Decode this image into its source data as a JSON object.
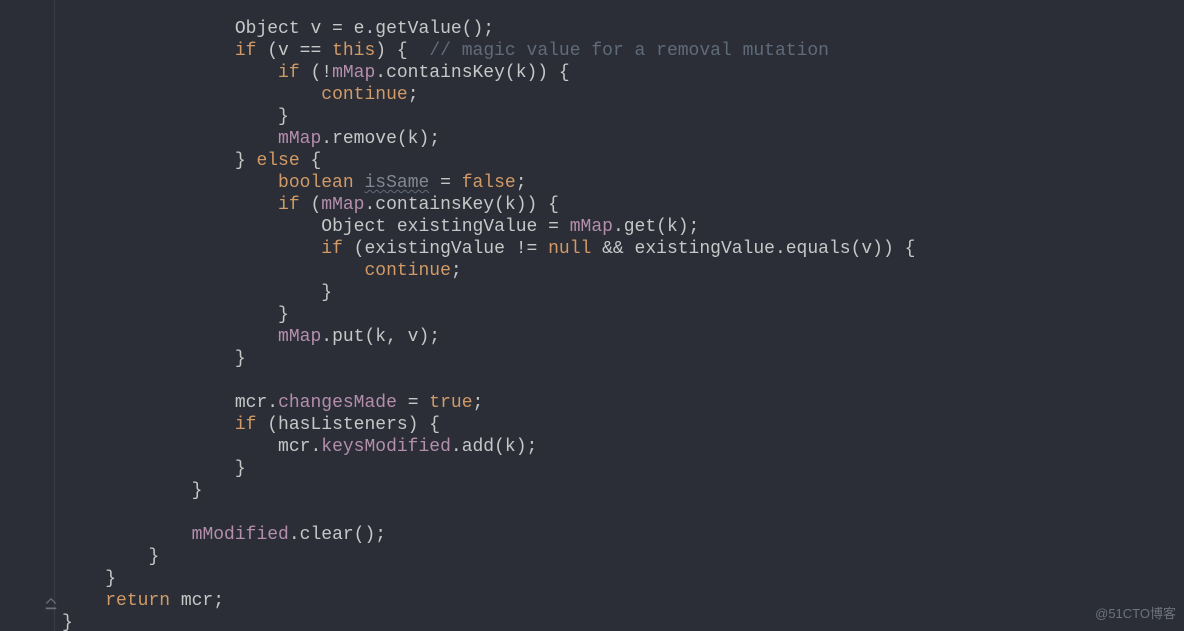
{
  "watermark": "@51CTO博客",
  "code": {
    "l0": {
      "ind": "            ",
      "a": "Object v = e.getValue();"
    },
    "l1": {
      "ind": "            ",
      "kw": "if",
      "a": " (v == ",
      "kw2": "this",
      "b": ") {  ",
      "cmt": "// magic value for a removal mutation"
    },
    "l2": {
      "ind": "                ",
      "kw": "if",
      "a": " (!",
      "fld": "mMap",
      "b": ".containsKey(k)) {"
    },
    "l3": {
      "ind": "                    ",
      "kw": "continue",
      "a": ";"
    },
    "l4": {
      "ind": "                ",
      "a": "}"
    },
    "l5": {
      "ind": "                ",
      "fld": "mMap",
      "a": ".remove(k);"
    },
    "l6": {
      "ind": "            ",
      "a": "} ",
      "kw": "else",
      "b": " {"
    },
    "l7": {
      "ind": "                ",
      "kw": "boolean",
      "a": " ",
      "un": "isSame",
      "b": " = ",
      "kw2": "false",
      "c": ";"
    },
    "l8": {
      "ind": "                ",
      "kw": "if",
      "a": " (",
      "fld": "mMap",
      "b": ".containsKey(k)) {"
    },
    "l9": {
      "ind": "                    ",
      "a": "Object existingValue = ",
      "fld": "mMap",
      "b": ".get(k);"
    },
    "l10": {
      "ind": "                    ",
      "kw": "if",
      "a": " (existingValue != ",
      "kw2": "null",
      "b": " && existingValue.equals(v)) {"
    },
    "l11": {
      "ind": "                        ",
      "kw": "continue",
      "a": ";"
    },
    "l12": {
      "ind": "                    ",
      "a": "}"
    },
    "l13": {
      "ind": "                ",
      "a": "}"
    },
    "l14": {
      "ind": "                ",
      "fld": "mMap",
      "a": ".put(k, v);"
    },
    "l15": {
      "ind": "            ",
      "a": "}"
    },
    "l16": {
      "ind": "",
      "a": ""
    },
    "l17": {
      "ind": "            ",
      "a": "mcr.",
      "fld": "changesMade",
      "b": " = ",
      "kw": "true",
      "c": ";"
    },
    "l18": {
      "ind": "            ",
      "kw": "if",
      "a": " (hasListeners) {"
    },
    "l19": {
      "ind": "                ",
      "a": "mcr.",
      "fld": "keysModified",
      "b": ".add(k);"
    },
    "l20": {
      "ind": "            ",
      "a": "}"
    },
    "l21": {
      "ind": "        ",
      "a": "}"
    },
    "l22": {
      "ind": "",
      "a": ""
    },
    "l23": {
      "ind": "        ",
      "fld": "mModified",
      "a": ".clear();"
    },
    "l24": {
      "ind": "    ",
      "a": "}"
    },
    "l25": {
      "ind": "",
      "a": "}"
    },
    "l26": {
      "ind": "",
      "kw": "return",
      "a": " mcr;"
    },
    "l27": {
      "ind": "",
      "a": "}"
    }
  },
  "indent_prefix": "    "
}
